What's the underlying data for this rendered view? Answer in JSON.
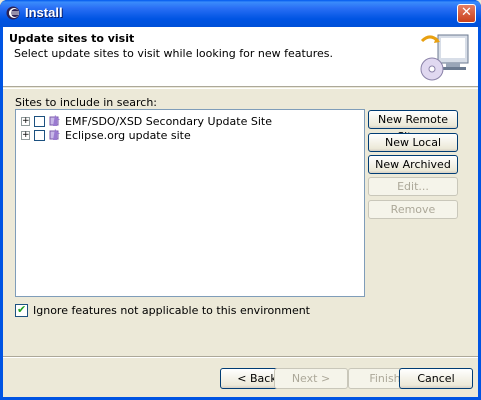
{
  "window": {
    "title": "Install",
    "close_label": "✕"
  },
  "banner": {
    "title": "Update sites to visit",
    "description": "Select update sites to visit while looking for new features."
  },
  "sites": {
    "label": "Sites to include in search:",
    "items": [
      {
        "label": "EMF/SDO/XSD Secondary Update Site",
        "checked": false,
        "expander": "+"
      },
      {
        "label": "Eclipse.org update site",
        "checked": false,
        "expander": "+"
      }
    ]
  },
  "side_buttons": {
    "new_remote": "New Remote Site...",
    "new_local": "New Local Site...",
    "new_archived": "New Archived Site...",
    "edit": "Edit...",
    "remove": "Remove"
  },
  "ignore_option": {
    "label": "Ignore features not applicable to this environment",
    "checked": true
  },
  "footer": {
    "back": "< Back",
    "next": "Next >",
    "finish": "Finish",
    "cancel": "Cancel"
  },
  "colors": {
    "titlebar": "#0054e3",
    "dialog_bg": "#ece9d8",
    "banner_bg": "#ffffff"
  }
}
